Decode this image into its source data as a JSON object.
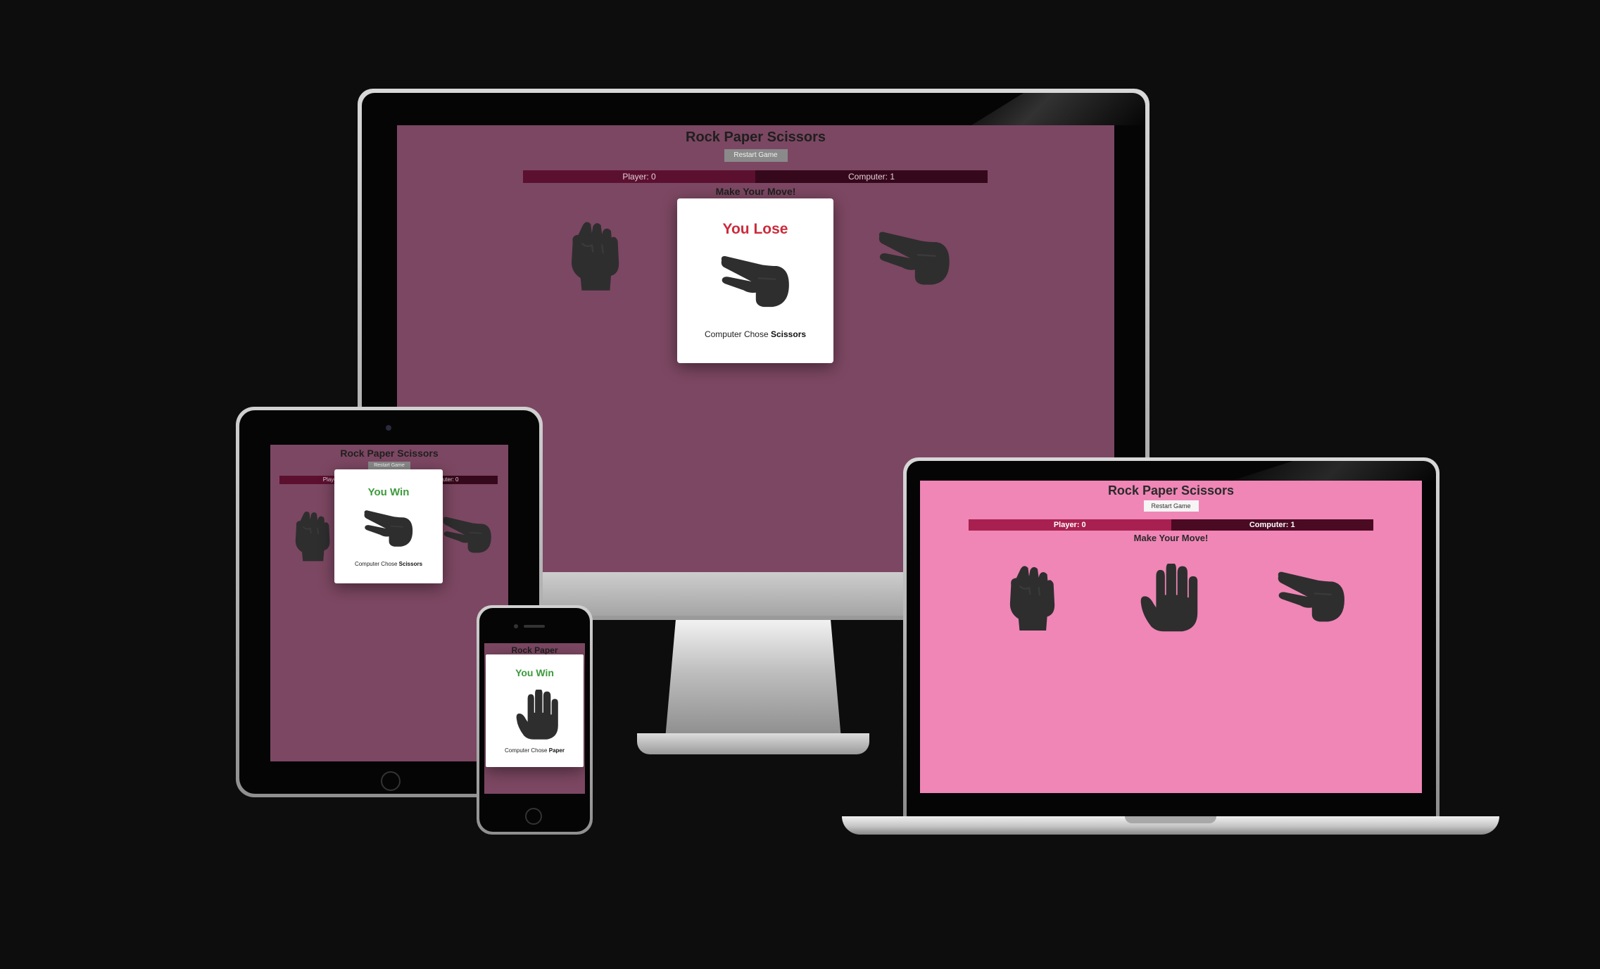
{
  "colors": {
    "background": "#0e0d0e",
    "screen_purple": "#7c4762",
    "screen_pink": "#ef86b6",
    "player_bar_dark": "#5c1030",
    "computer_bar_dark": "#36081b",
    "player_bar_pink": "#a8204f",
    "computer_bar_pink": "#4a0a22",
    "hand": "#2e2e2e",
    "lose": "#cc2b3c",
    "win": "#3c9a3c"
  },
  "desktop": {
    "title": "Rock Paper Scissors",
    "restart_label": "Restart Game",
    "player_score": "Player: 0",
    "computer_score": "Computer: 1",
    "prompt": "Make Your Move!",
    "hands": [
      "rock-icon",
      "scissors-icon"
    ],
    "modal": {
      "result": "You Lose",
      "hand": "scissors-icon",
      "chose_prefix": "Computer Chose",
      "choice": "Scissors"
    }
  },
  "tablet": {
    "title": "Rock Paper Scissors",
    "restart_label": "Restart Game",
    "player_score": "Player: 0",
    "computer_score": "Computer: 0",
    "hands": [
      "rock-icon",
      "scissors-icon"
    ],
    "modal": {
      "result": "You Win",
      "hand": "scissors-icon",
      "chose_prefix": "Computer Chose",
      "choice": "Scissors"
    }
  },
  "phone": {
    "title": "Rock Paper",
    "modal": {
      "result": "You Win",
      "hand": "paper-icon",
      "chose_prefix": "Computer Chose",
      "choice": "Paper"
    }
  },
  "laptop": {
    "title": "Rock Paper Scissors",
    "restart_label": "Restart Game",
    "player_score": "Player: 0",
    "computer_score": "Computer: 1",
    "prompt": "Make Your Move!",
    "hands": [
      "rock-icon",
      "paper-icon",
      "scissors-icon"
    ]
  }
}
